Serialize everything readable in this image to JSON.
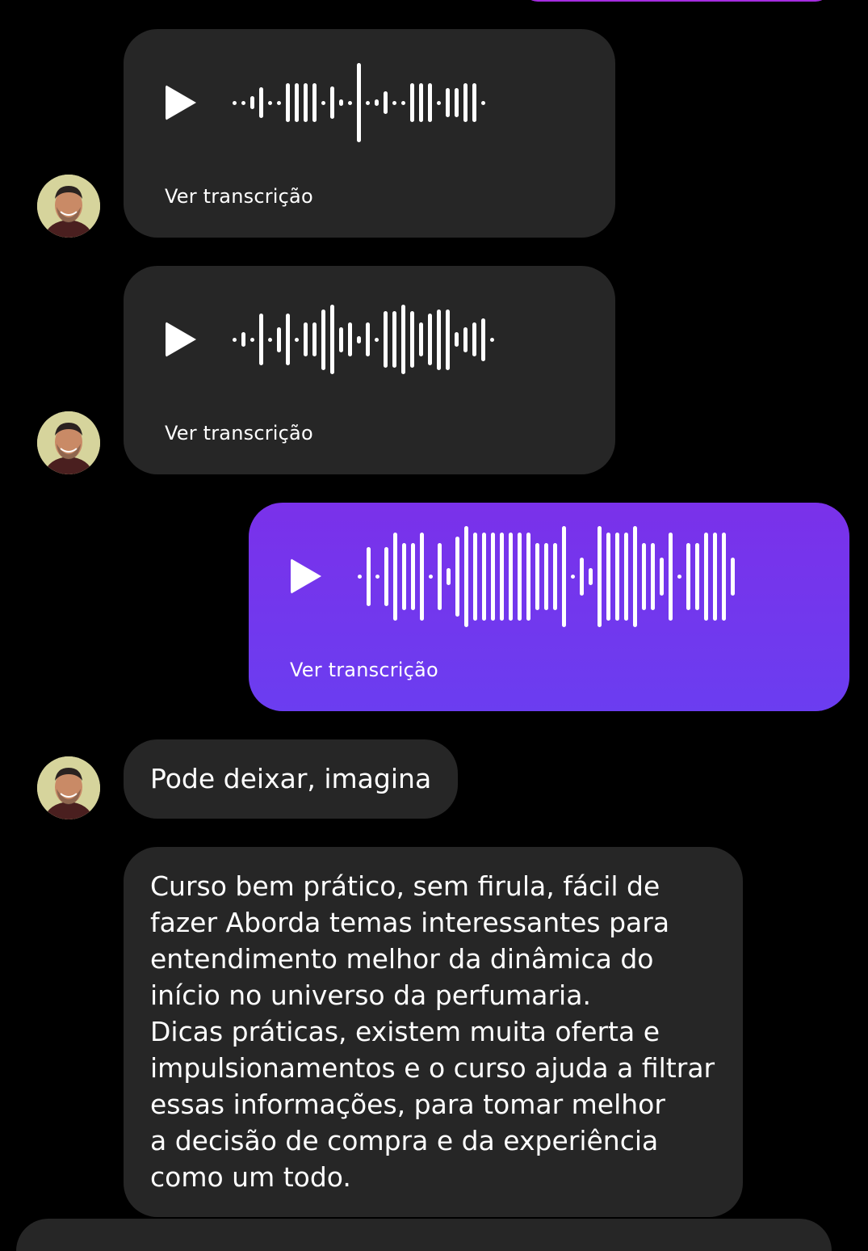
{
  "messages": [
    {
      "type": "audio",
      "direction": "incoming",
      "transcript_link": "Ver transcrição",
      "waveform": [
        0.04,
        0.04,
        0.16,
        0.38,
        0.04,
        0.04,
        0.48,
        0.48,
        0.48,
        0.48,
        0.04,
        0.4,
        0.08,
        0.04,
        0.98,
        0.04,
        0.08,
        0.28,
        0.04,
        0.04,
        0.48,
        0.48,
        0.48,
        0.04,
        0.36,
        0.36,
        0.48,
        0.48,
        0.04
      ]
    },
    {
      "type": "audio",
      "direction": "incoming",
      "transcript_link": "Ver transcrição",
      "waveform": [
        0.04,
        0.16,
        0.04,
        0.58,
        0.04,
        0.28,
        0.58,
        0.04,
        0.38,
        0.38,
        0.68,
        0.78,
        0.28,
        0.38,
        0.08,
        0.38,
        0.04,
        0.64,
        0.64,
        0.78,
        0.64,
        0.38,
        0.58,
        0.68,
        0.68,
        0.16,
        0.28,
        0.38,
        0.48,
        0.04
      ]
    },
    {
      "type": "audio",
      "direction": "outgoing",
      "transcript_link": "Ver transcrição",
      "waveform": [
        0.04,
        0.56,
        0.04,
        0.56,
        0.84,
        0.64,
        0.64,
        0.84,
        0.04,
        0.64,
        0.16,
        0.76,
        0.96,
        0.84,
        0.84,
        0.84,
        0.84,
        0.84,
        0.84,
        0.84,
        0.64,
        0.64,
        0.64,
        0.96,
        0.04,
        0.36,
        0.16,
        0.96,
        0.84,
        0.84,
        0.84,
        0.96,
        0.64,
        0.64,
        0.36,
        0.84,
        0.04,
        0.64,
        0.64,
        0.84,
        0.84,
        0.84,
        0.36
      ]
    },
    {
      "type": "text",
      "direction": "incoming",
      "text": "Pode deixar, imagina"
    },
    {
      "type": "text",
      "direction": "incoming",
      "text": "Curso bem prático, sem firula, fácil de\nfazer Aborda temas interessantes para\nentendimento melhor da dinâmica do\ninício no universo da perfumaria.\nDicas práticas, existem muita oferta e\nimpulsionamentos e o curso ajuda a filtrar\nessas informações, para tomar melhor\na decisão de compra e da experiência\ncomo um todo."
    }
  ],
  "colors": {
    "incoming_bubble": "#262626",
    "outgoing_bubble": "#7433ee",
    "background": "#000000"
  },
  "icons": {
    "play": "play-icon",
    "avatar": "contact-avatar"
  }
}
